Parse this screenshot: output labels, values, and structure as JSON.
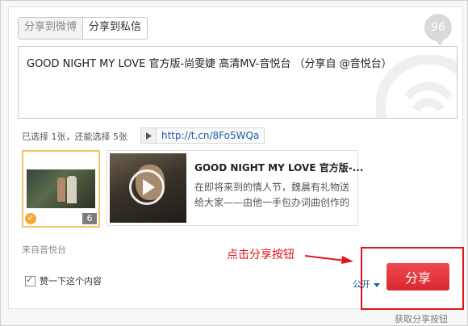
{
  "tabs": [
    {
      "label": "分享到微博"
    },
    {
      "label": "分享到私信"
    }
  ],
  "counter": "96",
  "share_text": "GOOD NIGHT MY LOVE 官方版-尚雯婕 高清MV-音悦台 （分享自 @音悦台）",
  "selection": {
    "info": "已选择 1张，还能选择 5张",
    "link": "http://t.cn/8Fo5WQa"
  },
  "thumbnail": {
    "count": "6",
    "check": "✓"
  },
  "card": {
    "title": "GOOD NIGHT MY LOVE 官方版-...",
    "description": "在即将来到的情人节，魏晨有礼物送给大家——由他一手包办词曲创作的"
  },
  "source": "来自音悦台",
  "annotation": "点击分享按钮",
  "like_label": "赞一下这个内容",
  "visibility": "公开",
  "share_button": "分享",
  "footer": "获取分享按钮",
  "colors": {
    "accent_red": "#e2141a",
    "button_red": "#e0323a",
    "link_blue": "#1f5fa8",
    "highlight_orange": "#f2c26b"
  }
}
